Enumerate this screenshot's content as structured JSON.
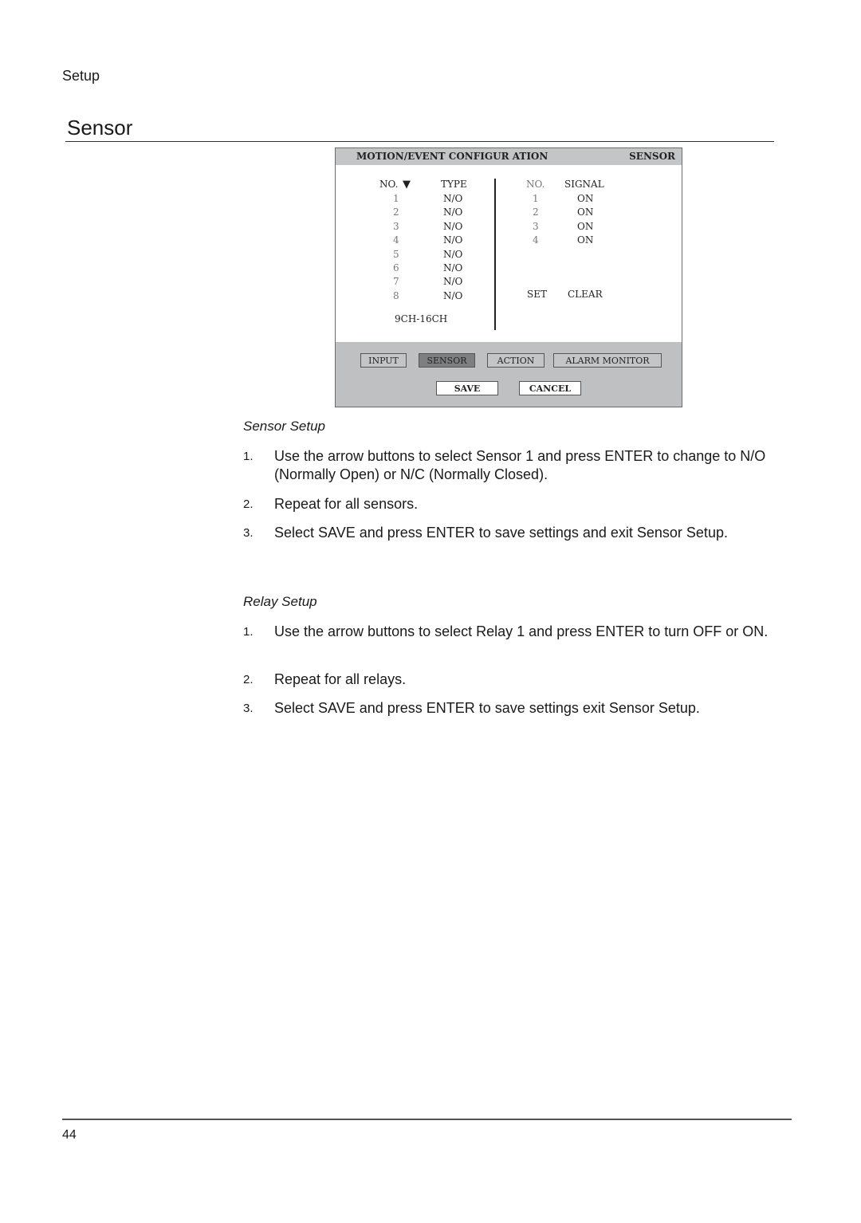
{
  "page": {
    "running_head": "Setup",
    "section_title": "Sensor",
    "page_number": "44"
  },
  "dialog": {
    "title": "MOTION/EVENT CONFIGUR ATION",
    "mode": "SENSOR",
    "sensor_table": {
      "headers": {
        "no": "NO.",
        "sort_icon": "▼",
        "type": "TYPE"
      },
      "rows": [
        {
          "no": "1",
          "type": "N/O"
        },
        {
          "no": "2",
          "type": "N/O"
        },
        {
          "no": "3",
          "type": "N/O"
        },
        {
          "no": "4",
          "type": "N/O"
        },
        {
          "no": "5",
          "type": "N/O"
        },
        {
          "no": "6",
          "type": "N/O"
        },
        {
          "no": "7",
          "type": "N/O"
        },
        {
          "no": "8",
          "type": "N/O"
        }
      ],
      "range_label": "9CH-16CH"
    },
    "relay_table": {
      "headers": {
        "no": "NO.",
        "signal": "SIGNAL"
      },
      "rows": [
        {
          "no": "1",
          "signal": "ON"
        },
        {
          "no": "2",
          "signal": "ON"
        },
        {
          "no": "3",
          "signal": "ON"
        },
        {
          "no": "4",
          "signal": "ON"
        }
      ],
      "set_label": "SET",
      "clear_label": "CLEAR"
    },
    "tabs": [
      {
        "label": "INPUT",
        "active": false
      },
      {
        "label": "SENSOR",
        "active": true
      },
      {
        "label": "ACTION",
        "active": false
      },
      {
        "label": "ALARM MONITOR",
        "active": false
      }
    ],
    "save_label": "SAVE",
    "cancel_label": "CANCEL"
  },
  "sensor_setup": {
    "heading": "Sensor Setup",
    "steps": [
      {
        "n": "1.",
        "text": "Use the arrow buttons to select Sensor 1 and press ENTER to change to N/O (Normally Open) or N/C (Normally Closed)."
      },
      {
        "n": "2.",
        "text": "Repeat for all sensors."
      },
      {
        "n": "3.",
        "text": "Select SAVE and press ENTER to save settings and exit Sensor Setup."
      }
    ]
  },
  "relay_setup": {
    "heading": "Relay Setup",
    "steps": [
      {
        "n": "1.",
        "text": "Use the arrow buttons to select Relay 1 and press ENTER to turn OFF or ON."
      },
      {
        "n": "2.",
        "text": "Repeat for all relays."
      },
      {
        "n": "3.",
        "text": "Select SAVE and press ENTER to save settings exit Sensor Setup."
      }
    ]
  }
}
